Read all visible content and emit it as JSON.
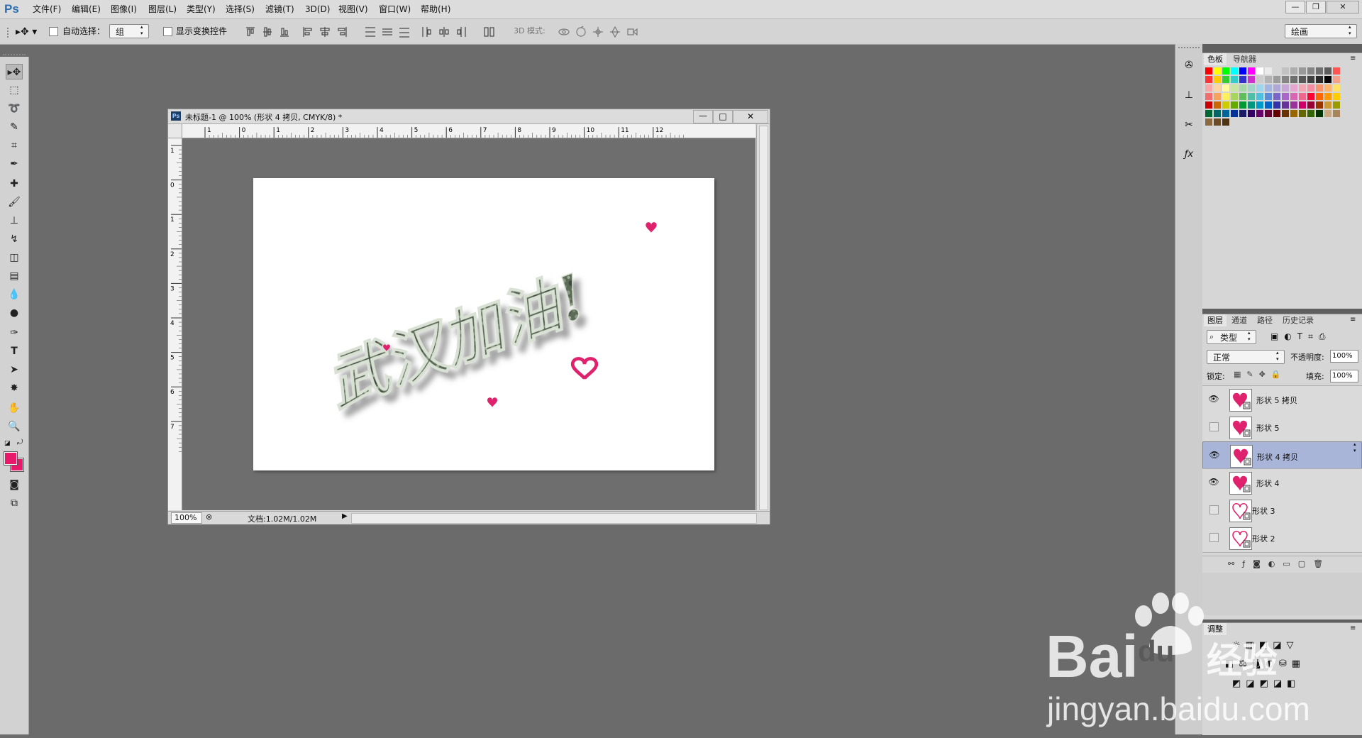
{
  "app": {
    "logo": "Ps"
  },
  "menu": [
    "文件(F)",
    "编辑(E)",
    "图像(I)",
    "图层(L)",
    "类型(Y)",
    "选择(S)",
    "滤镜(T)",
    "3D(D)",
    "视图(V)",
    "窗口(W)",
    "帮助(H)"
  ],
  "window_controls": {
    "minimize": "—",
    "restore": "❐",
    "close": "✕"
  },
  "options": {
    "auto_select_label": "自动选择：",
    "auto_select_value": "组",
    "show_transform_label": "显示变换控件",
    "mode_3d_label": "3D 模式:",
    "workspace_value": "绘画"
  },
  "document": {
    "title": "未标题-1 @ 100% (形状 4 拷贝, CMYK/8) *",
    "zoom": "100%",
    "doc_info": "文档:1.02M/1.02M",
    "ruler_h": [
      "1",
      "0",
      "1",
      "2",
      "3",
      "4",
      "5",
      "6",
      "7",
      "8",
      "9",
      "10",
      "11",
      "12"
    ],
    "ruler_v": [
      "1",
      "0",
      "1",
      "2",
      "3",
      "4",
      "5",
      "6",
      "7"
    ],
    "canvas_text": "武汉加油!"
  },
  "swatches_panel": {
    "tabs": [
      "色板",
      "导航器"
    ]
  },
  "swatch_colors": [
    "#ff0000",
    "#ffff00",
    "#00ff00",
    "#00ffff",
    "#0000ff",
    "#ff00ff",
    "#ffffff",
    "#ebebeb",
    "#d6d6d6",
    "#c2c2c2",
    "#adadad",
    "#999999",
    "#858585",
    "#707070",
    "#5c5c5c",
    "#ff5555",
    "#ff3333",
    "#ffcc00",
    "#33cc33",
    "#33cccc",
    "#3333cc",
    "#cc33cc",
    "#cccccc",
    "#b3b3b3",
    "#9c9c9c",
    "#858585",
    "#6e6e6e",
    "#575757",
    "#404040",
    "#292929",
    "#000000",
    "#f5a088",
    "#f7a8a8",
    "#fbd6a0",
    "#fffaa0",
    "#c9e6a0",
    "#a6d9a6",
    "#9fd6c9",
    "#9ed4ec",
    "#a3b6e0",
    "#b0a6d8",
    "#c9a6d8",
    "#e6a6cf",
    "#f2a6b3",
    "#f58ca0",
    "#f7946d",
    "#f9b36b",
    "#ffe166",
    "#f26d6d",
    "#f7a25c",
    "#fff05c",
    "#a8d65c",
    "#5cbf5c",
    "#4dbfa8",
    "#4dbfe0",
    "#5c8cd9",
    "#7a66c9",
    "#a866c9",
    "#d966b3",
    "#f0668c",
    "#ff0033",
    "#ff6600",
    "#ff9900",
    "#ffcc00",
    "#cc0000",
    "#cc6600",
    "#cccc00",
    "#66aa00",
    "#009933",
    "#009980",
    "#0099cc",
    "#0066cc",
    "#3333aa",
    "#663399",
    "#993399",
    "#cc0066",
    "#990033",
    "#993300",
    "#cc9933",
    "#999900",
    "#006633",
    "#006666",
    "#006699",
    "#003399",
    "#1a1a66",
    "#330066",
    "#660066",
    "#660033",
    "#660000",
    "#663300",
    "#996600",
    "#666600",
    "#336600",
    "#003300",
    "#c9a880",
    "#a8845c",
    "#8c6a3f",
    "#6b4c26",
    "#4d3312"
  ],
  "layers_panel": {
    "tabs": [
      "图层",
      "通道",
      "路径",
      "历史记录"
    ],
    "filter_label": "类型",
    "blend_mode": "正常",
    "opacity_label": "不透明度:",
    "opacity_value": "100%",
    "lock_label": "锁定:",
    "fill_label": "填充:",
    "fill_value": "100%",
    "layers": [
      {
        "name": "形状 5 拷贝",
        "visible": true,
        "selected": false,
        "filled": true
      },
      {
        "name": "形状 5",
        "visible": false,
        "selected": false,
        "filled": true
      },
      {
        "name": "形状 4 拷贝",
        "visible": true,
        "selected": true,
        "filled": true
      },
      {
        "name": "形状 4",
        "visible": true,
        "selected": false,
        "filled": true
      },
      {
        "name": "形状 3",
        "visible": false,
        "selected": false,
        "filled": false
      },
      {
        "name": "形状 2",
        "visible": false,
        "selected": false,
        "filled": false
      }
    ]
  },
  "adjustments_panel": {
    "title": "调整"
  },
  "colors": {
    "foreground": "#e8196b",
    "background": "#e8196b",
    "heart": "#e0226e",
    "selection": "#a8b5d8"
  },
  "watermark": {
    "brand": "Bai",
    "du_text": "du",
    "cn_text": "经验",
    "url": "jingyan.baidu.com"
  }
}
